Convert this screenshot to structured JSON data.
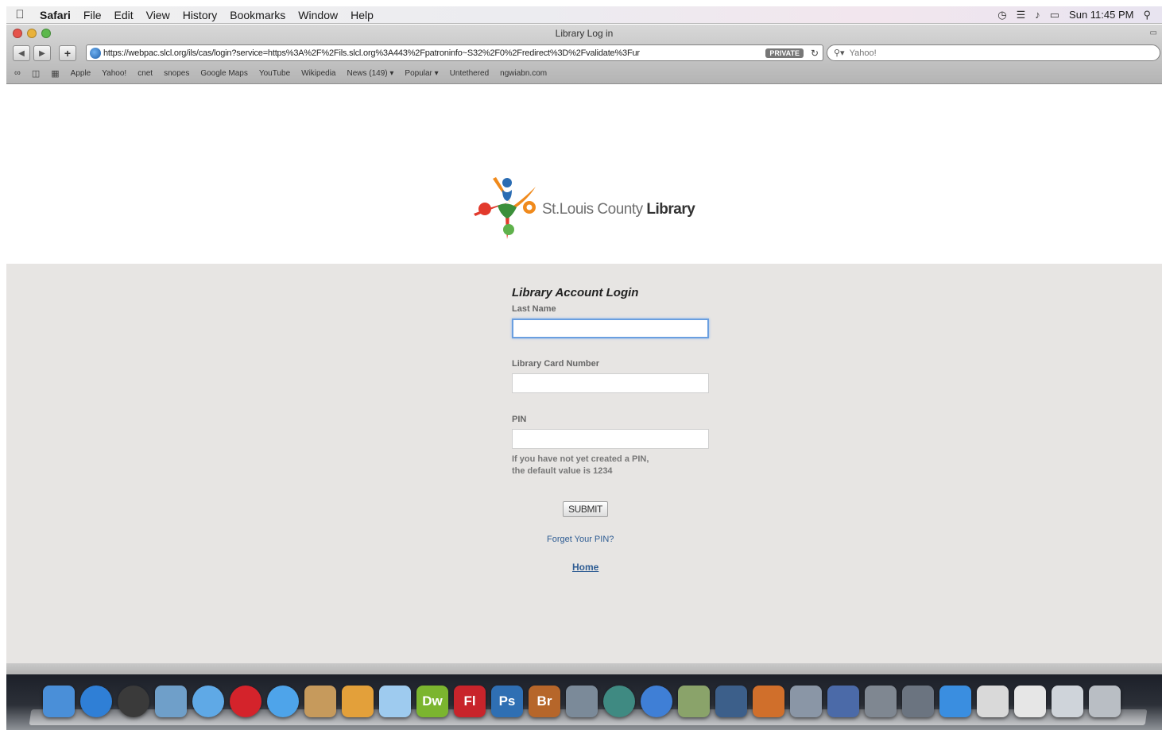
{
  "menubar": {
    "app_name": "Safari",
    "items": [
      "File",
      "Edit",
      "View",
      "History",
      "Bookmarks",
      "Window",
      "Help"
    ],
    "clock": "Sun 11:45 PM"
  },
  "window": {
    "title": "Library Log in"
  },
  "address": {
    "url": "https://webpac.slcl.org/ils/cas/login?service=https%3A%2F%2Fils.slcl.org%3A443%2Fpatroninfo~S32%2F0%2Fredirect%3D%2Fvalidate%3Fur",
    "private_badge": "PRIVATE",
    "search_placeholder": "Yahoo!"
  },
  "bookmarks": [
    "Apple",
    "Yahoo!",
    "cnet",
    "snopes",
    "Google Maps",
    "YouTube",
    "Wikipedia",
    "News (149) ▾",
    "Popular ▾",
    "Untethered",
    "ngwiabn.com"
  ],
  "logo": {
    "text_light": "St.Louis County ",
    "text_bold": "Library"
  },
  "login": {
    "title": "Library Account Login",
    "last_name_label": "Last Name",
    "last_name_value": "",
    "card_label": "Library Card Number",
    "card_value": "",
    "pin_label": "PIN",
    "pin_value": "",
    "pin_hint_line1": "If you have not yet created a PIN,",
    "pin_hint_line2": "the default value is 1234",
    "submit_label": "SUBMIT",
    "forgot_link": "Forget Your PIN?",
    "home_link": "Home"
  },
  "dock": {
    "apps": [
      {
        "name": "finder-icon",
        "label": "",
        "color": "#4a8fd8"
      },
      {
        "name": "app-store-icon",
        "label": "",
        "color": "#2f7fd6"
      },
      {
        "name": "dashboard-icon",
        "label": "",
        "color": "#3a3a3a"
      },
      {
        "name": "preview-icon",
        "label": "",
        "color": "#6f9fc9"
      },
      {
        "name": "safari-icon",
        "label": "",
        "color": "#5fa9e6"
      },
      {
        "name": "opera-icon",
        "label": "",
        "color": "#d4232b"
      },
      {
        "name": "ichat-icon",
        "label": "",
        "color": "#4ea4ea"
      },
      {
        "name": "address-book-icon",
        "label": "",
        "color": "#c69a5c"
      },
      {
        "name": "people-icon",
        "label": "",
        "color": "#e3a03a"
      },
      {
        "name": "package-icon",
        "label": "",
        "color": "#9ecbef"
      },
      {
        "name": "dreamweaver-icon",
        "label": "Dw",
        "color": "#7bb52f"
      },
      {
        "name": "flash-icon",
        "label": "Fl",
        "color": "#c8242b"
      },
      {
        "name": "photoshop-icon",
        "label": "Ps",
        "color": "#2f6fb3"
      },
      {
        "name": "bridge-icon",
        "label": "Br",
        "color": "#b6662a"
      },
      {
        "name": "photo-booth-icon",
        "label": "",
        "color": "#7b8a99"
      },
      {
        "name": "time-machine-icon",
        "label": "",
        "color": "#3f8a82"
      },
      {
        "name": "itunes-icon",
        "label": "",
        "color": "#3f7fd6"
      },
      {
        "name": "iphoto-icon",
        "label": "",
        "color": "#8aa36a"
      },
      {
        "name": "spaces-icon",
        "label": "",
        "color": "#3c5f8a"
      },
      {
        "name": "keynote-icon",
        "label": "",
        "color": "#d06f2b"
      },
      {
        "name": "pen-icon",
        "label": "",
        "color": "#8a96a6"
      },
      {
        "name": "grapher-icon",
        "label": "",
        "color": "#4b6aa8"
      },
      {
        "name": "system-prefs-icon",
        "label": "",
        "color": "#7f8791"
      },
      {
        "name": "grab-icon",
        "label": "",
        "color": "#6b7480"
      },
      {
        "name": "downloads-icon",
        "label": "",
        "color": "#3a8ee0"
      },
      {
        "name": "documents-icon",
        "label": "",
        "color": "#d9d9d9"
      },
      {
        "name": "file-icon",
        "label": "",
        "color": "#e6e6e6"
      },
      {
        "name": "folder-icon",
        "label": "",
        "color": "#cfd4da"
      },
      {
        "name": "trash-icon",
        "label": "",
        "color": "#b9bec4"
      }
    ]
  }
}
